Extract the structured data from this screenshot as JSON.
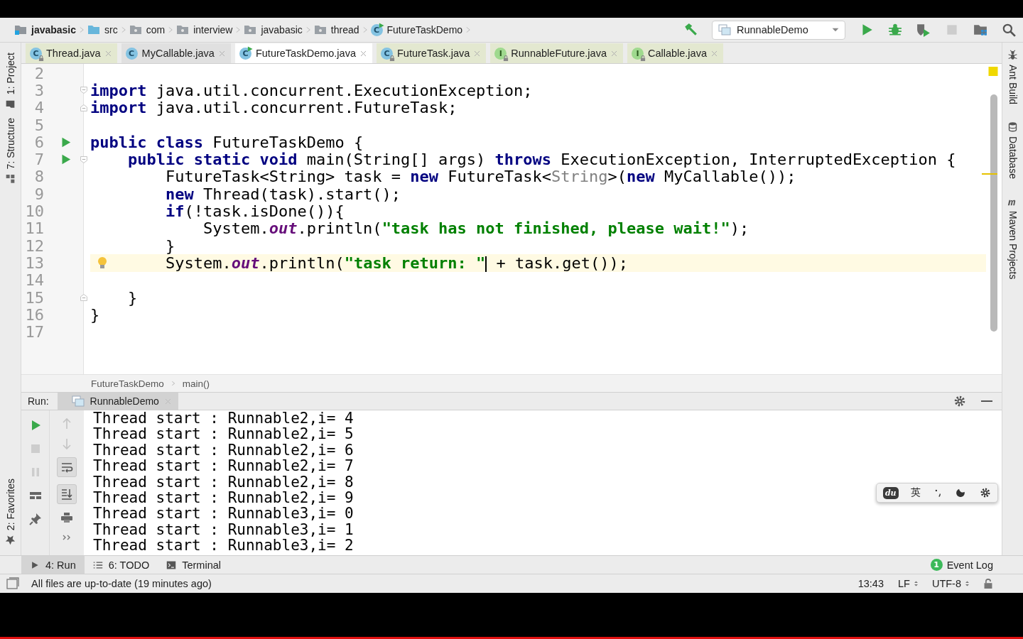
{
  "navigation_bar": {
    "breadcrumbs": [
      {
        "label": "javabasic",
        "kind": "module"
      },
      {
        "label": "src",
        "kind": "source"
      },
      {
        "label": "com",
        "kind": "package"
      },
      {
        "label": "interview",
        "kind": "package"
      },
      {
        "label": "javabasic",
        "kind": "package"
      },
      {
        "label": "thread",
        "kind": "package"
      },
      {
        "label": "FutureTaskDemo",
        "kind": "class",
        "icon": "C",
        "runnable": true
      }
    ],
    "toolbar": [
      {
        "kind": "build"
      },
      {
        "kind": "config",
        "label": "RunnableDemo"
      },
      {
        "kind": "run"
      },
      {
        "kind": "debug"
      },
      {
        "kind": "coverage"
      },
      {
        "kind": "stop",
        "disabled": true
      },
      {
        "kind": "project-structure"
      },
      {
        "kind": "search"
      }
    ]
  },
  "left_tool_windows_top": [
    {
      "label": "1: Project",
      "kind": "project"
    },
    {
      "label": "7: Structure",
      "kind": "structure"
    }
  ],
  "left_tool_windows_bottom": [
    {
      "label": "2: Favorites",
      "kind": "favorites"
    }
  ],
  "right_tool_windows": [
    {
      "label": "Ant Build",
      "kind": "ant"
    },
    {
      "label": "Database",
      "kind": "database"
    },
    {
      "label": "Maven Projects",
      "kind": "maven"
    }
  ],
  "editor_tabs": [
    {
      "label": "Thread.java",
      "icon": "C",
      "read_only": true,
      "runnable": false,
      "selected": false
    },
    {
      "label": "MyCallable.java",
      "icon": "C",
      "read_only": false,
      "runnable": false,
      "selected": false
    },
    {
      "label": "FutureTaskDemo.java",
      "icon": "C",
      "read_only": false,
      "runnable": true,
      "selected": true
    },
    {
      "label": "FutureTask.java",
      "icon": "C",
      "read_only": true,
      "runnable": false,
      "selected": false
    },
    {
      "label": "RunnableFuture.java",
      "icon": "I",
      "read_only": true,
      "runnable": false,
      "selected": false
    },
    {
      "label": "Callable.java",
      "icon": "I",
      "read_only": true,
      "runnable": false,
      "selected": false
    }
  ],
  "editor": {
    "lines": [
      {
        "number": "2"
      },
      {
        "number": "3",
        "fold_start": true,
        "tokens": [
          {
            "text": "import",
            "kind": "keyword"
          },
          {
            "text": " java.util.concurrent.ExecutionException;",
            "kind": "plain"
          }
        ]
      },
      {
        "number": "4",
        "fold_end": true,
        "tokens": [
          {
            "text": "import",
            "kind": "keyword"
          },
          {
            "text": " java.util.concurrent.FutureTask;",
            "kind": "plain"
          }
        ]
      },
      {
        "number": "5"
      },
      {
        "number": "6",
        "run_marker": true,
        "tokens": [
          {
            "text": "public class",
            "kind": "keyword"
          },
          {
            "text": " FutureTaskDemo {",
            "kind": "plain"
          }
        ]
      },
      {
        "number": "7",
        "run_marker": true,
        "fold_start": true,
        "tokens": [
          {
            "text": "    public static void",
            "kind": "keyword"
          },
          {
            "text": " main(String[] args) ",
            "kind": "plain"
          },
          {
            "text": "throws",
            "kind": "keyword"
          },
          {
            "text": " ExecutionException, InterruptedException {",
            "kind": "plain"
          }
        ]
      },
      {
        "number": "8",
        "tokens": [
          {
            "text": "        FutureTask<String> task = ",
            "kind": "plain"
          },
          {
            "text": "new",
            "kind": "keyword"
          },
          {
            "text": " FutureTask<",
            "kind": "plain"
          },
          {
            "text": "String",
            "kind": "dim"
          },
          {
            "text": ">(",
            "kind": "plain"
          },
          {
            "text": "new",
            "kind": "keyword"
          },
          {
            "text": " MyCallable());",
            "kind": "plain"
          }
        ]
      },
      {
        "number": "9",
        "tokens": [
          {
            "text": "        new",
            "kind": "keyword"
          },
          {
            "text": " Thread(task).start();",
            "kind": "plain"
          }
        ]
      },
      {
        "number": "10",
        "tokens": [
          {
            "text": "        if",
            "kind": "keyword"
          },
          {
            "text": "(!task.isDone()){",
            "kind": "plain"
          }
        ]
      },
      {
        "number": "11",
        "tokens": [
          {
            "text": "            System.",
            "kind": "plain"
          },
          {
            "text": "out",
            "kind": "field"
          },
          {
            "text": ".println(",
            "kind": "plain"
          },
          {
            "text": "\"task has not finished, please wait!\"",
            "kind": "string"
          },
          {
            "text": ");",
            "kind": "plain"
          }
        ]
      },
      {
        "number": "12",
        "tokens": [
          {
            "text": "        }",
            "kind": "plain"
          }
        ]
      },
      {
        "number": "13",
        "current": true,
        "intention": true,
        "tokens": [
          {
            "text": "        System.",
            "kind": "plain"
          },
          {
            "text": "out",
            "kind": "field"
          },
          {
            "text": ".println(",
            "kind": "plain"
          },
          {
            "text": "\"task return: \"",
            "kind": "string",
            "caret": true
          },
          {
            "text": " + task.get());",
            "kind": "plain"
          }
        ]
      },
      {
        "number": "14"
      },
      {
        "number": "15",
        "fold_end": true,
        "tokens": [
          {
            "text": "    }",
            "kind": "plain"
          }
        ]
      },
      {
        "number": "16",
        "tokens": [
          {
            "text": "}",
            "kind": "plain"
          }
        ]
      },
      {
        "number": "17"
      }
    ]
  },
  "editor_breadcrumbs": [
    "FutureTaskDemo",
    "main()"
  ],
  "run_panel": {
    "label": "Run:",
    "tabs": [
      {
        "label": "RunnableDemo",
        "selected": true
      }
    ],
    "toolbar_1": [
      {
        "kind": "rerun",
        "disabled": false
      },
      {
        "kind": "stop",
        "disabled": true
      },
      {
        "kind": "pause",
        "disabled": true
      },
      {
        "kind": "layout",
        "disabled": false
      },
      {
        "kind": "pin",
        "disabled": false
      }
    ],
    "toolbar_2": [
      {
        "kind": "up",
        "disabled": true
      },
      {
        "kind": "down",
        "disabled": true
      },
      {
        "kind": "soft-wrap",
        "on": true
      },
      {
        "kind": "scroll-end",
        "on": true
      },
      {
        "kind": "print"
      },
      {
        "kind": "more"
      }
    ],
    "output": [
      "Thread start : Runnable2,i= 4",
      "Thread start : Runnable2,i= 5",
      "Thread start : Runnable2,i= 6",
      "Thread start : Runnable2,i= 7",
      "Thread start : Runnable2,i= 8",
      "Thread start : Runnable2,i= 9",
      "Thread start : Runnable3,i= 0",
      "Thread start : Runnable3,i= 1",
      "Thread start : Runnable3,i= 2"
    ]
  },
  "input_method_bar": {
    "logo": "du",
    "language": "英"
  },
  "bottom_tabs": [
    {
      "label": "4: Run",
      "kind": "run",
      "selected": true
    },
    {
      "label": "6: TODO",
      "kind": "todo",
      "selected": false
    },
    {
      "label": "Terminal",
      "kind": "terminal",
      "selected": false
    }
  ],
  "event_log": {
    "count": "1",
    "label": "Event Log"
  },
  "status_bar": {
    "message": "All files are up-to-date (19 minutes ago)",
    "position": "13:43",
    "line_separator": "LF",
    "encoding": "UTF-8"
  }
}
